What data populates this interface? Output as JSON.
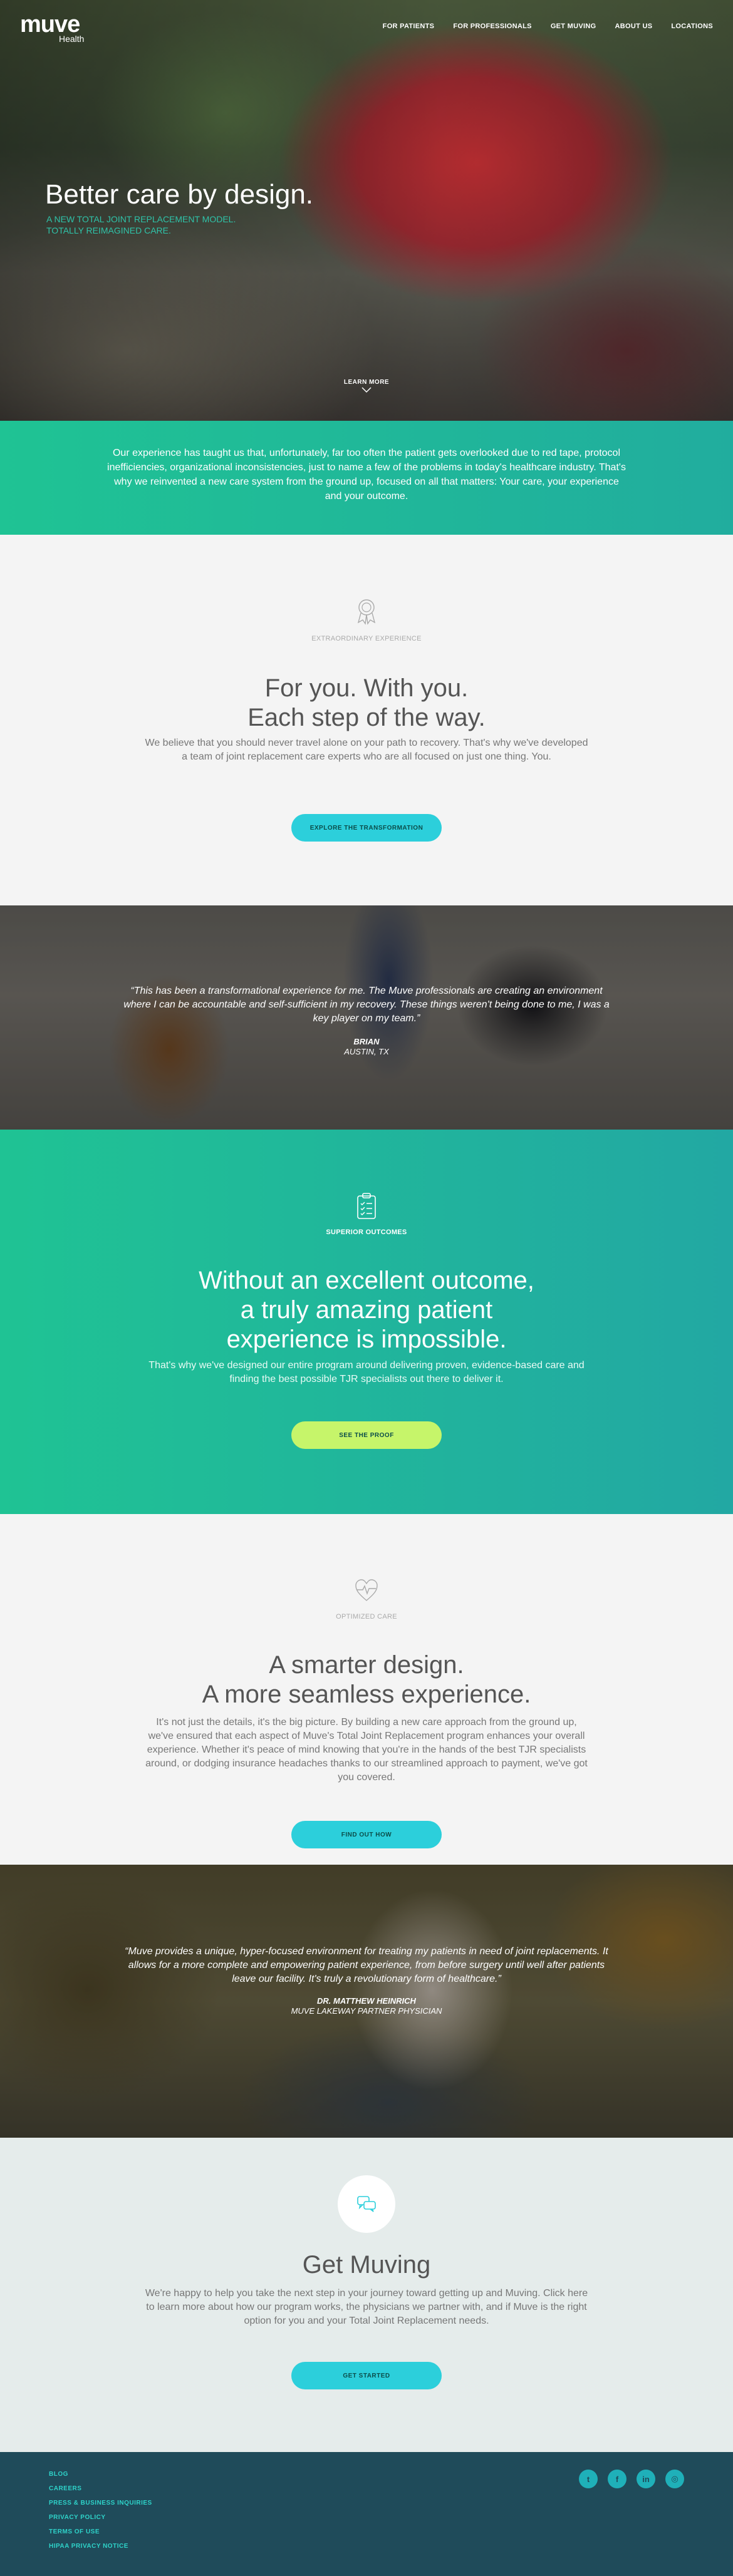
{
  "header": {
    "logo": "muve",
    "logo_sub": "Health",
    "nav": [
      "FOR PATIENTS",
      "FOR PROFESSIONALS",
      "GET MUVING",
      "ABOUT US",
      "LOCATIONS"
    ]
  },
  "hero": {
    "title": "Better care by design.",
    "subtitle": "A NEW TOTAL JOINT REPLACEMENT MODEL. TOTALLY REIMAGINED CARE.",
    "learn_more": "LEARN MORE"
  },
  "intro": {
    "text": "Our experience has taught us that, unfortunately, far too often the patient gets overlooked due to red tape, protocol inefficiencies, organizational inconsistencies, just to name a few of the problems in today's healthcare industry. That's why we reinvented a new care system from the ground up, focused on all that matters: Your care, your experience and your outcome."
  },
  "for_you": {
    "icon": "award-icon",
    "kicker": "EXTRAORDINARY EXPERIENCE",
    "heading_line1": "For you. With you.",
    "heading_line2": "Each step of the way.",
    "text": "We believe that you should never travel alone on your path to recovery. That's why we've developed a team of joint replacement care experts who are all focused on just one thing. You.",
    "button": "EXPLORE THE TRANSFORMATION"
  },
  "quote1": {
    "text": "“This has been a transformational experience for me. The Muve professionals are creating an environment where I can be accountable and self-sufficient in my recovery. These things weren't being done to me, I was a key player on my team.”",
    "name": "BRIAN",
    "role": "AUSTIN, TX"
  },
  "outcomes": {
    "icon": "clipboard-icon",
    "kicker": "SUPERIOR OUTCOMES",
    "heading_line1": "Without an excellent outcome,",
    "heading_line2": "a truly amazing patient",
    "heading_line3": "experience is impossible.",
    "text": "That's why we've designed our entire program around delivering proven, evidence-based care and finding the best possible TJR specialists out there to deliver it.",
    "button": "SEE THE PROOF"
  },
  "design": {
    "icon": "heartbeat-icon",
    "kicker": "OPTIMIZED CARE",
    "heading_line1": "A smarter design.",
    "heading_line2": "A more seamless experience.",
    "text": "It's not just the details, it's the big picture. By building a new care approach from the ground up, we've ensured that each aspect of Muve's Total Joint Replacement program enhances your overall experience. Whether it's peace of mind knowing that you're in the hands of the best TJR specialists around, or dodging insurance headaches thanks to our streamlined approach to payment, we've got you covered.",
    "button": "FIND OUT HOW"
  },
  "quote2": {
    "text": "“Muve provides a unique, hyper-focused environment for treating my patients in need of joint replacements. It allows for a more complete and empowering patient experience, from before surgery until well after patients leave our facility. It's truly a revolutionary form of healthcare.”",
    "name": "DR. MATTHEW HEINRICH",
    "role": "MUVE LAKEWAY PARTNER PHYSICIAN"
  },
  "muving": {
    "icon": "chat-bubbles-icon",
    "heading": "Get Muving",
    "text": "We're happy to help you take the next step in your journey toward getting up and Muving. Click here to learn more about how our program works, the physicians we partner with, and if Muve is the right option for you and your Total Joint Replacement needs.",
    "button": "GET STARTED"
  },
  "footer": {
    "links": [
      "BLOG",
      "CAREERS",
      "PRESS & BUSINESS INQUIRIES",
      "PRIVACY POLICY",
      "TERMS OF USE",
      "HIPAA PRIVACY NOTICE"
    ],
    "social": [
      {
        "name": "twitter",
        "glyph": "t"
      },
      {
        "name": "facebook",
        "glyph": "f"
      },
      {
        "name": "linkedin",
        "glyph": "in"
      },
      {
        "name": "instagram",
        "glyph": "◎"
      }
    ]
  },
  "colors": {
    "teal_gradient_start": "#1fc394",
    "teal_gradient_end": "#21ad9e",
    "button_teal": "#2ccfdb",
    "button_lime": "#c6f56a",
    "footer_bg": "#1f4b5a",
    "footer_link": "#2ed3c9"
  }
}
